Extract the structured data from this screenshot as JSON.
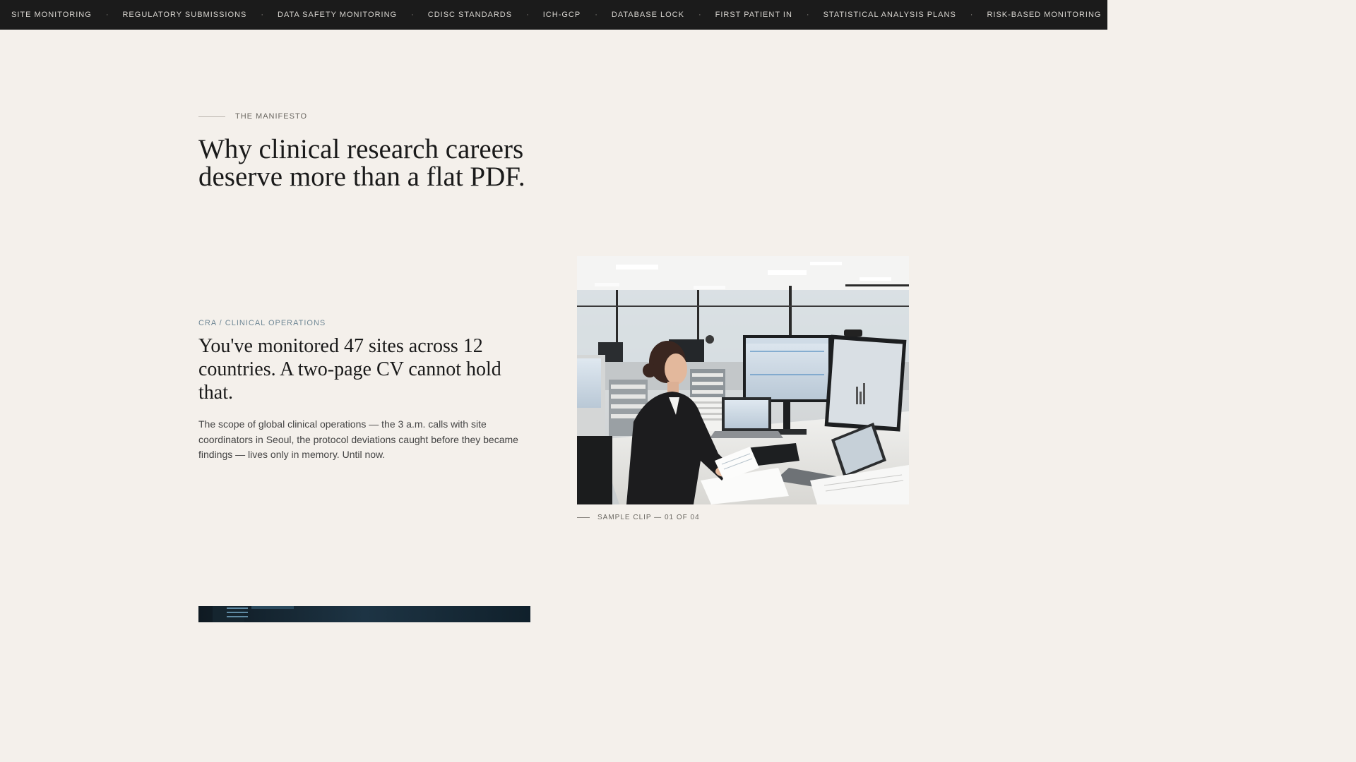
{
  "ticker": {
    "items": [
      "SITE MONITORING",
      "REGULATORY SUBMISSIONS",
      "DATA SAFETY MONITORING",
      "CDISC STANDARDS",
      "ICH-GCP",
      "DATABASE LOCK",
      "FIRST PATIENT IN",
      "STATISTICAL ANALYSIS PLANS",
      "RISK-BASED MONITORING"
    ],
    "separator": "·"
  },
  "manifesto": {
    "eyebrow": "THE MANIFESTO",
    "title": "Why clinical research careers deserve more than a flat PDF."
  },
  "feature": {
    "category": "CRA / CLINICAL OPERATIONS",
    "heading": "You've monitored 47 sites across 12 countries. A two-page CV cannot hold that.",
    "body": "The scope of global clinical operations — the 3 a.m. calls with site coordinators in Seoul, the protocol deviations caught before they became findings — lives only in memory. Until now.",
    "caption": "SAMPLE CLIP — 01 OF 04"
  },
  "colors": {
    "page_bg": "#f4f0eb",
    "ticker_bg": "#1b1b1b",
    "ticker_text": "#d9d6d1",
    "category_accent": "#6f8795"
  }
}
